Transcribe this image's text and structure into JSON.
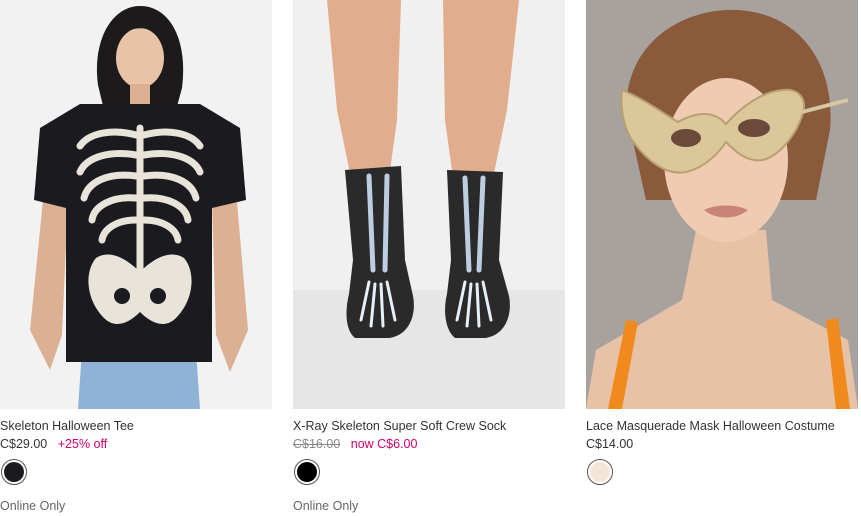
{
  "products": [
    {
      "title": "Skeleton Halloween Tee",
      "price": "C$29.00",
      "promo": "+25% off",
      "swatch_color": "#1b1a1e",
      "availability": "Online Only"
    },
    {
      "title": "X-Ray Skeleton Super Soft Crew Sock",
      "original_price": "C$16.00",
      "sale_price": "now C$6.00",
      "swatch_color": "#000000",
      "availability": "Online Only"
    },
    {
      "title": "Lace Masquerade Mask Halloween Costume",
      "price": "C$14.00",
      "swatch_color": "#f3e6d8"
    }
  ],
  "colors": {
    "promo": "#d4006a",
    "text": "#333333",
    "muted": "#8a8a8a"
  }
}
